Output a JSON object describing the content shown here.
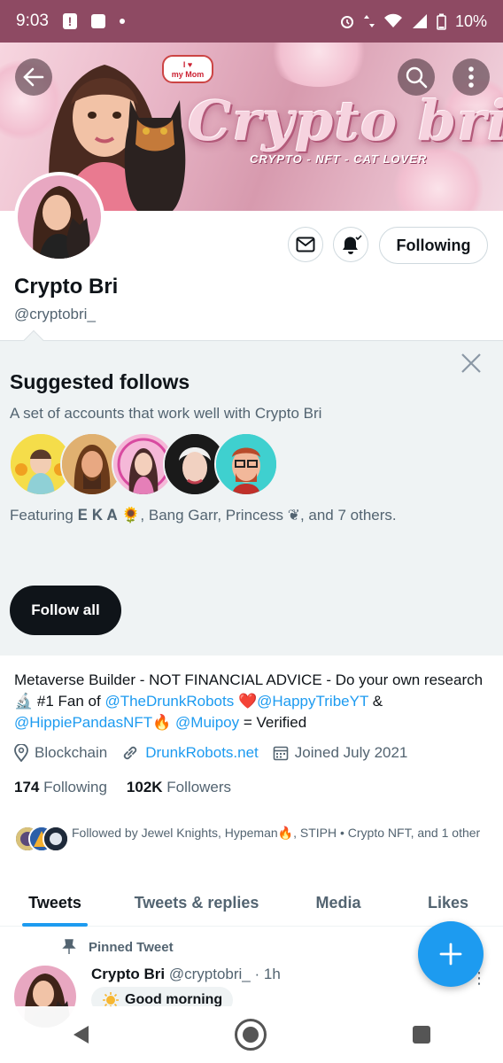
{
  "status_bar": {
    "time": "9:03",
    "battery": "10%"
  },
  "banner": {
    "title": "Crypto bri",
    "subtitle": "CRYPTO - NFT - CAT LOVER",
    "speech_line1": "I ♥",
    "speech_line2": "my Mom"
  },
  "header": {
    "back_icon": "arrow-left-icon",
    "search_icon": "search-icon",
    "more_icon": "more-vertical-icon"
  },
  "profile": {
    "display_name": "Crypto Bri",
    "handle": "@cryptobri_",
    "following_button": "Following"
  },
  "suggested": {
    "title": "Suggested follows",
    "description": "A set of accounts that work well with Crypto Bri",
    "featuring": "Featuring 𝐄 𝐊 𝐀 🌻, Bang Garr, Princess ❦, and 7 others.",
    "follow_all": "Follow all"
  },
  "bio": {
    "line1": "Metaverse Builder - NOT FINANCIAL ADVICE - Do your own research 🔬 #1 Fan of ",
    "mention1": "@TheDrunkRobots",
    "mid1": " ❤️",
    "mention2": "@HappyTribeYT",
    "mid2": " & ",
    "mention3": "@HippiePandasNFT",
    "mid3": "🔥 ",
    "mention4": "@Muipoy",
    "end": " = Verified"
  },
  "meta": {
    "location": "Blockchain",
    "website": "DrunkRobots.net",
    "joined": "Joined July 2021"
  },
  "counts": {
    "following_num": "174",
    "following_label": "Following",
    "followers_num": "102K",
    "followers_label": "Followers"
  },
  "followed_by": "Followed by Jewel Knights, Hypeman🔥, STIPH • Crypto NFT, and 1 other",
  "tabs": [
    {
      "label": "Tweets"
    },
    {
      "label": "Tweets & replies"
    },
    {
      "label": "Media"
    },
    {
      "label": "Likes"
    }
  ],
  "pinned": {
    "label": "Pinned Tweet",
    "name": "Crypto Bri",
    "handle_time": "@cryptobri_ · 1h",
    "text": "Good morning"
  },
  "colors": {
    "accent": "#1d9bf0",
    "status_bar": "#8e4a63",
    "text_primary": "#0f1419",
    "text_secondary": "#536471"
  }
}
